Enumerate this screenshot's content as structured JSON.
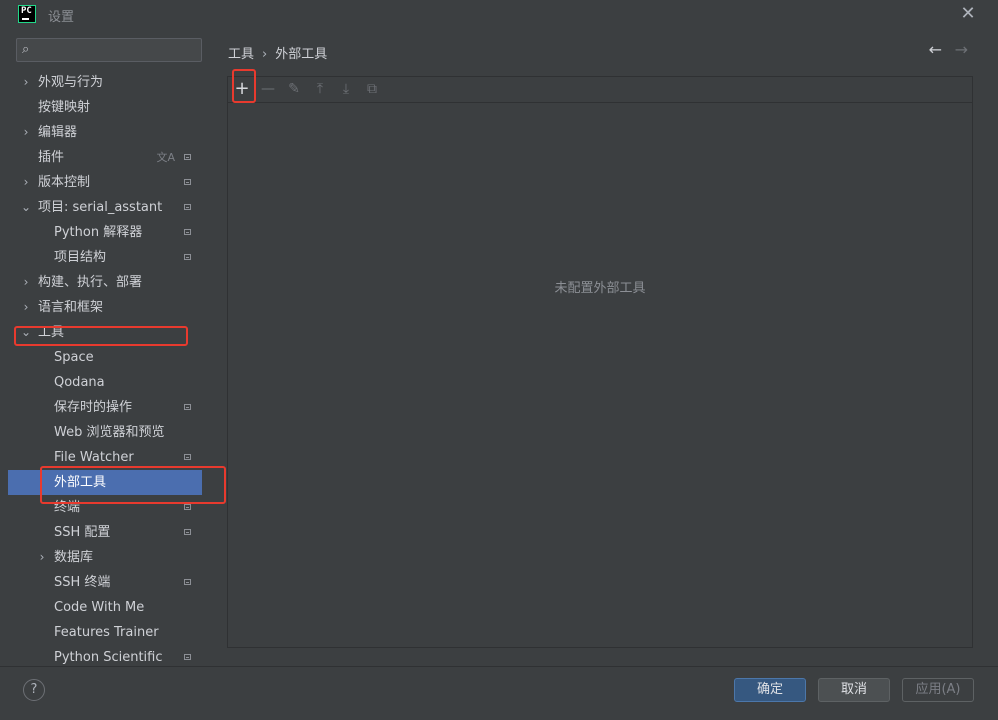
{
  "window": {
    "title": "设置",
    "logo_text": "PC",
    "close_glyph": "✕"
  },
  "search": {
    "value": "",
    "placeholder": ""
  },
  "tree": [
    {
      "label": "外观与行为",
      "level": 0,
      "expandable": true,
      "expanded": false,
      "settings_icon": false
    },
    {
      "label": "按键映射",
      "level": 0,
      "expandable": false,
      "expanded": false,
      "settings_icon": false
    },
    {
      "label": "编辑器",
      "level": 0,
      "expandable": true,
      "expanded": false,
      "settings_icon": false
    },
    {
      "label": "插件",
      "level": 0,
      "expandable": false,
      "expanded": false,
      "settings_icon": true,
      "translate_icon": true
    },
    {
      "label": "版本控制",
      "level": 0,
      "expandable": true,
      "expanded": false,
      "settings_icon": true
    },
    {
      "label": "项目: serial_asstant",
      "level": 0,
      "expandable": true,
      "expanded": true,
      "settings_icon": true
    },
    {
      "label": "Python 解释器",
      "level": 1,
      "expandable": false,
      "expanded": false,
      "settings_icon": true
    },
    {
      "label": "项目结构",
      "level": 1,
      "expandable": false,
      "expanded": false,
      "settings_icon": true
    },
    {
      "label": "构建、执行、部署",
      "level": 0,
      "expandable": true,
      "expanded": false,
      "settings_icon": false
    },
    {
      "label": "语言和框架",
      "level": 0,
      "expandable": true,
      "expanded": false,
      "settings_icon": false
    },
    {
      "label": "工具",
      "level": 0,
      "expandable": true,
      "expanded": true,
      "settings_icon": false
    },
    {
      "label": "Space",
      "level": 1,
      "expandable": false,
      "expanded": false,
      "settings_icon": false
    },
    {
      "label": "Qodana",
      "level": 1,
      "expandable": false,
      "expanded": false,
      "settings_icon": false
    },
    {
      "label": "保存时的操作",
      "level": 1,
      "expandable": false,
      "expanded": false,
      "settings_icon": true
    },
    {
      "label": "Web 浏览器和预览",
      "level": 1,
      "expandable": false,
      "expanded": false,
      "settings_icon": false
    },
    {
      "label": "File Watcher",
      "level": 1,
      "expandable": false,
      "expanded": false,
      "settings_icon": true
    },
    {
      "label": "外部工具",
      "level": 1,
      "expandable": false,
      "expanded": false,
      "settings_icon": false,
      "selected": true
    },
    {
      "label": "终端",
      "level": 1,
      "expandable": false,
      "expanded": false,
      "settings_icon": true
    },
    {
      "label": "SSH 配置",
      "level": 1,
      "expandable": false,
      "expanded": false,
      "settings_icon": true
    },
    {
      "label": "数据库",
      "level": 1,
      "expandable": true,
      "expanded": false,
      "settings_icon": false
    },
    {
      "label": "SSH 终端",
      "level": 1,
      "expandable": false,
      "expanded": false,
      "settings_icon": true
    },
    {
      "label": "Code With Me",
      "level": 1,
      "expandable": false,
      "expanded": false,
      "settings_icon": false
    },
    {
      "label": "Features Trainer",
      "level": 1,
      "expandable": false,
      "expanded": false,
      "settings_icon": false
    },
    {
      "label": "Python Scientific",
      "level": 1,
      "expandable": false,
      "expanded": false,
      "settings_icon": true
    }
  ],
  "breadcrumb": {
    "parent": "工具",
    "separator": "›",
    "current": "外部工具"
  },
  "nav": {
    "back_glyph": "←",
    "forward_glyph": "→"
  },
  "toolbar": {
    "add_glyph": "+",
    "remove_glyph": "—",
    "edit_glyph": "✎",
    "up_glyph": "⤒",
    "down_glyph": "⤓",
    "copy_glyph": "⧉"
  },
  "panel": {
    "empty_text": "未配置外部工具"
  },
  "footer": {
    "help_glyph": "?",
    "ok_label": "确定",
    "cancel_label": "取消",
    "apply_label": "应用(A)"
  },
  "colors": {
    "selection": "#4b6eaf",
    "highlight": "#e83a2e",
    "ok_button": "#365880"
  }
}
